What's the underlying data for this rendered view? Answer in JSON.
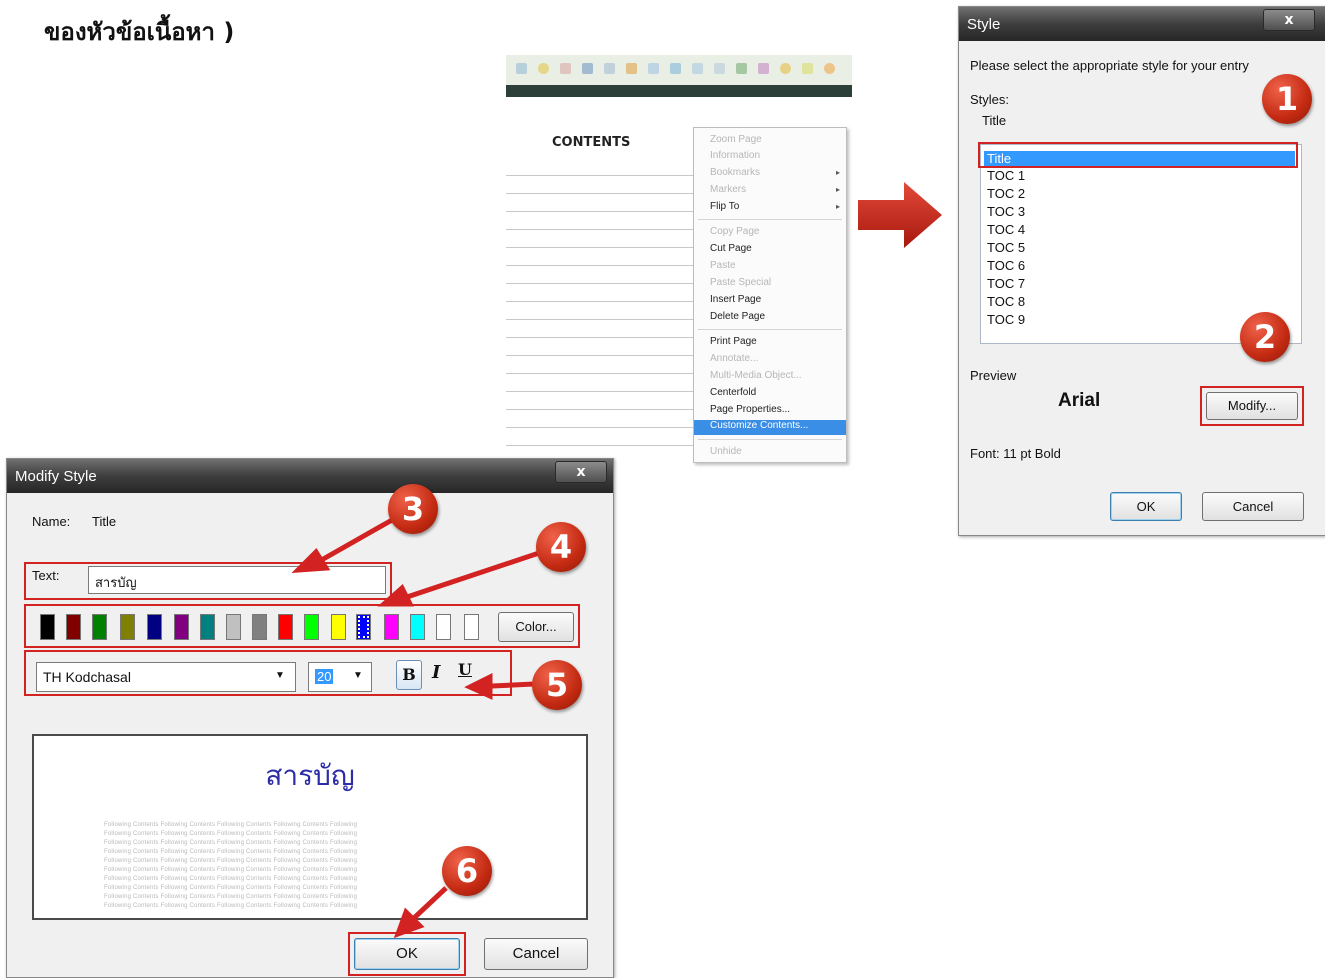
{
  "heading": "ของหัวข้อเนื้อหา )",
  "context_screenshot": {
    "page_title": "CONTENTS",
    "menu": [
      {
        "label": "Zoom Page",
        "enabled": false,
        "submenu": false
      },
      {
        "label": "Information",
        "enabled": false,
        "submenu": false
      },
      {
        "label": "Bookmarks",
        "enabled": false,
        "submenu": true
      },
      {
        "label": "Markers",
        "enabled": false,
        "submenu": true
      },
      {
        "label": "Flip To",
        "enabled": true,
        "submenu": true
      },
      {
        "label": "Copy Page",
        "enabled": false,
        "submenu": false
      },
      {
        "label": "Cut Page",
        "enabled": true,
        "submenu": false
      },
      {
        "label": "Paste",
        "enabled": false,
        "submenu": false
      },
      {
        "label": "Paste Special",
        "enabled": false,
        "submenu": false
      },
      {
        "label": "Insert Page",
        "enabled": true,
        "submenu": false
      },
      {
        "label": "Delete Page",
        "enabled": true,
        "submenu": false
      },
      {
        "label": "Print Page",
        "enabled": true,
        "submenu": false
      },
      {
        "label": "Annotate...",
        "enabled": false,
        "submenu": false
      },
      {
        "label": "Multi-Media Object...",
        "enabled": false,
        "submenu": false
      },
      {
        "label": "Centerfold",
        "enabled": true,
        "submenu": false
      },
      {
        "label": "Page Properties...",
        "enabled": true,
        "submenu": false
      },
      {
        "label": "Customize Contents...",
        "enabled": true,
        "submenu": false,
        "selected": true
      },
      {
        "label": "Unhide",
        "enabled": false,
        "submenu": false
      }
    ]
  },
  "style_dialog": {
    "title": "Style",
    "close": "x",
    "instruction": "Please select the appropriate style for your entry",
    "styles_label": "Styles:",
    "current_style": "Title",
    "styles": [
      "Title",
      "TOC 1",
      "TOC 2",
      "TOC 3",
      "TOC 4",
      "TOC 5",
      "TOC 6",
      "TOC 7",
      "TOC 8",
      "TOC 9"
    ],
    "selected_style": "Title",
    "preview_label": "Preview",
    "preview_font": "Arial",
    "modify_button": "Modify...",
    "font_info": "Font: 11 pt Bold",
    "ok_button": "OK",
    "cancel_button": "Cancel"
  },
  "modify_dialog": {
    "title": "Modify Style",
    "close": "x",
    "name_label": "Name:",
    "name_value": "Title",
    "text_label": "Text:",
    "text_value": "สารบัญ",
    "swatches": [
      "#000000",
      "#800000",
      "#008000",
      "#808000",
      "#000080",
      "#800080",
      "#008080",
      "#c0c0c0",
      "#808080",
      "#ff0000",
      "#00ff00",
      "#ffff00",
      "#0000ff",
      "#ff00ff",
      "#00ffff",
      "#ffffff",
      "#ffffff"
    ],
    "color_button": "Color...",
    "font_value": "TH Kodchasal",
    "size_value": "20",
    "bold_label": "B",
    "italic_label": "I",
    "underline_label": "U",
    "preview_text": "สารบัญ",
    "preview_text_color": "#2c2ca8",
    "filler_text": "Following Contents Following Contents Following Contents Following Contents Following",
    "ok_button": "OK",
    "cancel_button": "Cancel"
  },
  "step_badges": [
    "1",
    "2",
    "3",
    "4",
    "5",
    "6"
  ],
  "accent_red": "#d32222"
}
